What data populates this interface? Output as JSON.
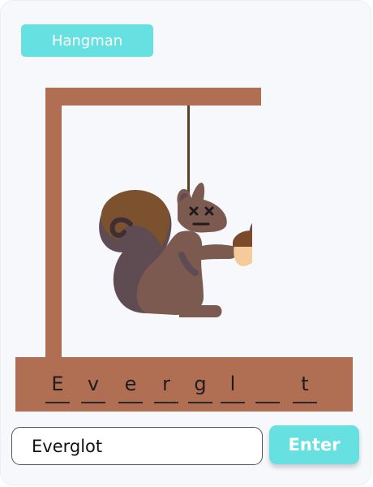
{
  "header": {
    "title": "Hangman"
  },
  "word_slots": [
    {
      "letter": "E"
    },
    {
      "letter": "v"
    },
    {
      "letter": "e"
    },
    {
      "letter": "r"
    },
    {
      "letter": "g"
    },
    {
      "letter": "l"
    },
    {
      "letter": ""
    },
    {
      "letter": "t"
    }
  ],
  "guess_input": {
    "value": "Everglot"
  },
  "enter_button": {
    "label": "Enter"
  },
  "colors": {
    "accent": "#66e0e0",
    "gallows": "#b06e52",
    "rope": "#5b3f24",
    "squirrel_body": "#7d5a50",
    "squirrel_tail": "#7b522d",
    "acorn_cap": "#7b4a2a",
    "acorn_nut": "#f6cb9a"
  }
}
